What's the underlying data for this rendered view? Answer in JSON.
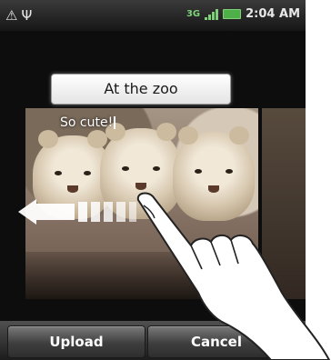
{
  "status_bar": {
    "network_badge_top": "3G",
    "time": "2:04 AM",
    "icons": [
      "alert-icon",
      "usb-icon",
      "network-3g-icon",
      "signal-icon",
      "battery-icon"
    ]
  },
  "album": {
    "title": "At the zoo"
  },
  "photo": {
    "caption": "So cute!",
    "subject_icon": "lion-cubs-photo"
  },
  "gesture": {
    "icon": "swipe-left-arrow-icon",
    "hand_icon": "pointing-hand-icon"
  },
  "buttons": {
    "upload": "Upload",
    "cancel": "Cancel"
  }
}
